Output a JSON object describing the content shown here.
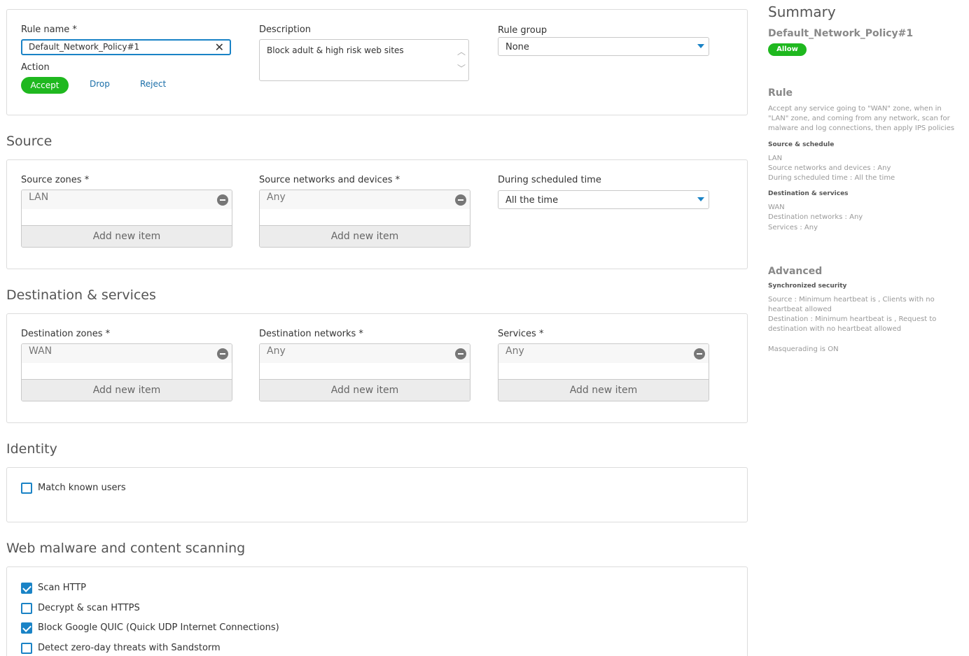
{
  "rule": {
    "name_label": "Rule name *",
    "name_value": "Default_Network_Policy#1",
    "description_label": "Description",
    "description_value": "Block adult & high risk web sites",
    "group_label": "Rule group",
    "group_value": "None",
    "action_label": "Action",
    "actions": {
      "accept": "Accept",
      "drop": "Drop",
      "reject": "Reject"
    },
    "selected_action": "Accept"
  },
  "source": {
    "title": "Source",
    "zones_label": "Source zones *",
    "zones_item": "LAN",
    "networks_label": "Source networks and devices *",
    "networks_item": "Any",
    "schedule_label": "During scheduled time",
    "schedule_value": "All the time",
    "add_new": "Add new item"
  },
  "destination": {
    "title": "Destination & services",
    "zones_label": "Destination zones *",
    "zones_item": "WAN",
    "networks_label": "Destination networks *",
    "networks_item": "Any",
    "services_label": "Services *",
    "services_item": "Any",
    "add_new": "Add new item"
  },
  "identity": {
    "title": "Identity",
    "match_known_users": "Match known users",
    "match_known_users_checked": false
  },
  "scanning": {
    "title": "Web malware and content scanning",
    "options": [
      {
        "label": "Scan HTTP",
        "checked": true
      },
      {
        "label": "Decrypt & scan HTTPS",
        "checked": false
      },
      {
        "label": "Block Google QUIC (Quick UDP Internet Connections)",
        "checked": true
      },
      {
        "label": "Detect zero-day threats with Sandstorm",
        "checked": false
      }
    ]
  },
  "summary": {
    "title": "Summary",
    "rule_name": "Default_Network_Policy#1",
    "badge": "Allow",
    "rule_heading": "Rule",
    "rule_text": "Accept any service going to \"WAN\" zone, when in \"LAN\" zone, and coming from any network, scan for malware and log connections, then apply IPS policies",
    "source_heading": "Source & schedule",
    "source_lines": [
      "LAN",
      "Source networks and devices : Any",
      "During scheduled time : All the time"
    ],
    "dest_heading": "Destination & services",
    "dest_lines": [
      "WAN",
      "Destination networks : Any",
      "Services : Any"
    ],
    "advanced_heading": "Advanced",
    "sync_heading": "Synchronized security",
    "sync_text_1": "Source : Minimum heartbeat is , Clients with no heartbeat allowed",
    "sync_text_2": "Destination : Minimum heartbeat is , Request to destination with no heartbeat allowed",
    "masquerading": "Masquerading is ON"
  },
  "colors": {
    "accent": "#1a83c6",
    "accept_green": "#1fb81f",
    "link": "#1a6ea8"
  }
}
